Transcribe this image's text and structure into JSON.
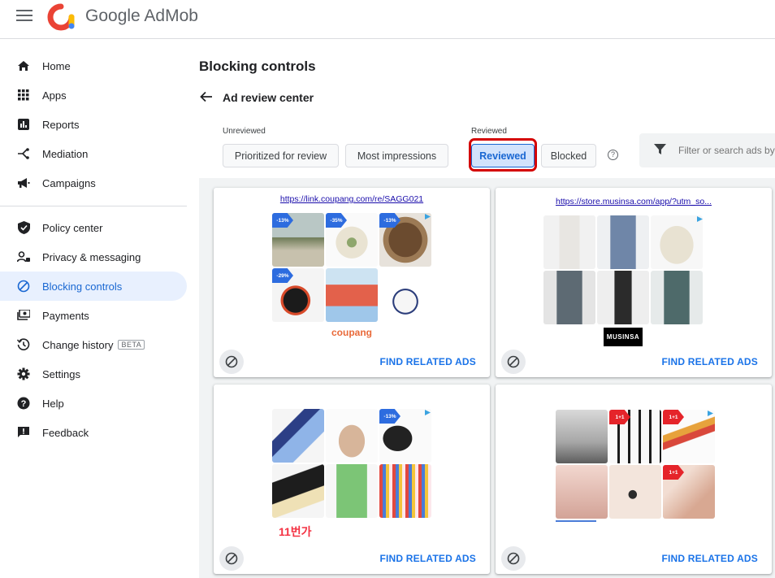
{
  "app": {
    "name": "Google AdMob"
  },
  "sidebar": {
    "items": [
      {
        "label": "Home",
        "icon": "home-icon"
      },
      {
        "label": "Apps",
        "icon": "apps-grid-icon"
      },
      {
        "label": "Reports",
        "icon": "reports-icon"
      },
      {
        "label": "Mediation",
        "icon": "mediation-icon"
      },
      {
        "label": "Campaigns",
        "icon": "megaphone-icon"
      },
      {
        "label": "Policy center",
        "icon": "shield-icon"
      },
      {
        "label": "Privacy & messaging",
        "icon": "privacy-icon"
      },
      {
        "label": "Blocking controls",
        "icon": "block-icon",
        "active": true
      },
      {
        "label": "Payments",
        "icon": "payments-icon"
      },
      {
        "label": "Change history",
        "icon": "history-icon",
        "badge": "BETA"
      },
      {
        "label": "Settings",
        "icon": "gear-icon"
      },
      {
        "label": "Help",
        "icon": "help-icon"
      },
      {
        "label": "Feedback",
        "icon": "feedback-icon"
      }
    ]
  },
  "page": {
    "title": "Blocking controls",
    "subtitle": "Ad review center"
  },
  "filters": {
    "unreviewed_label": "Unreviewed",
    "reviewed_label": "Reviewed",
    "prioritized_label": "Prioritized for review",
    "most_impressions_label": "Most impressions",
    "reviewed_chip_label": "Reviewed",
    "blocked_label": "Blocked",
    "help_glyph": "?",
    "search_placeholder": "Filter or search ads by"
  },
  "cards": [
    {
      "url": "https://link.coupang.com/re/SAGG021",
      "brand": "coupang",
      "action": "FIND RELATED ADS"
    },
    {
      "url": "https://store.musinsa.com/app/?utm_so...",
      "brand": "MUSINSA",
      "action": "FIND RELATED ADS"
    },
    {
      "url": "",
      "brand": "11번가",
      "action": "FIND RELATED ADS"
    },
    {
      "url": "",
      "brand": "",
      "action": "FIND RELATED ADS"
    }
  ],
  "badges": {
    "coupang": [
      "-13%",
      "-35%",
      "-13%",
      "-29%"
    ],
    "eleven": [
      "-13%"
    ],
    "fourth": [
      "1+1",
      "1+1",
      "1+1"
    ]
  },
  "colors": {
    "accent": "#1a73e8",
    "active_nav_bg": "#e8f0fe",
    "highlight_ring": "#d40000",
    "link": "#1a0dab"
  }
}
